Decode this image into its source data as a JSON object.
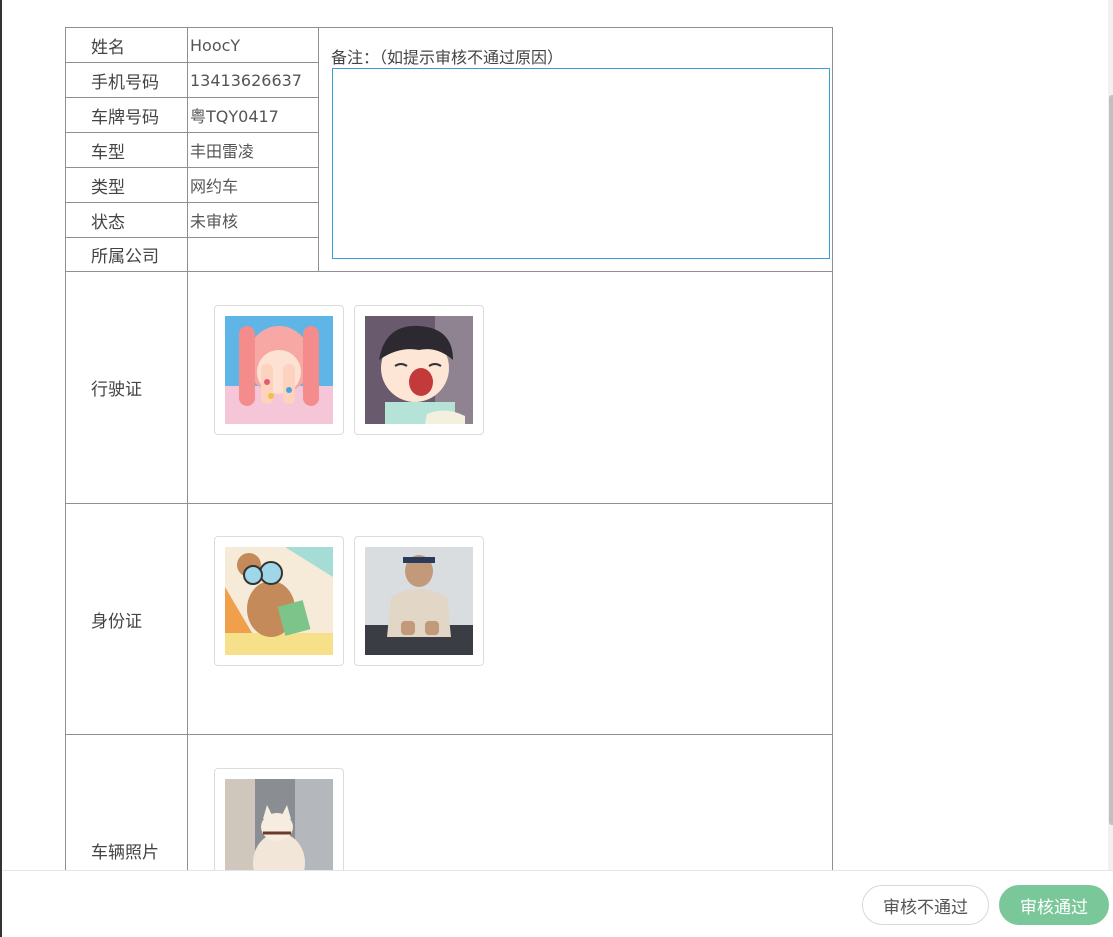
{
  "info": {
    "rows": [
      {
        "label": "姓名",
        "value": "HoocY"
      },
      {
        "label": "手机号码",
        "value": "13413626637"
      },
      {
        "label": "车牌号码",
        "value": "粤TQY0417"
      },
      {
        "label": "车型",
        "value": "丰田雷凌"
      },
      {
        "label": "类型",
        "value": "网约车"
      },
      {
        "label": "状态",
        "value": "未审核"
      },
      {
        "label": "所属公司",
        "value": ""
      }
    ]
  },
  "note": {
    "label": "备注：（如提示审核不通过原因）",
    "value": ""
  },
  "sections": [
    {
      "label": "行驶证",
      "images": [
        "anime-girl-covering-face-photo",
        "anime-boy-yawning-photo"
      ]
    },
    {
      "label": "身份证",
      "images": [
        "cartoon-mouse-with-book-photo",
        "man-with-headband-photo"
      ]
    },
    {
      "label": "车辆照片",
      "images": [
        "white-cat-photo"
      ]
    }
  ],
  "footer": {
    "reject_label": "审核不通过",
    "approve_label": "审核通过"
  },
  "colors": {
    "accent": "#3a9fd6",
    "approve": "#7ac89a",
    "border": "#8f8f8f"
  }
}
